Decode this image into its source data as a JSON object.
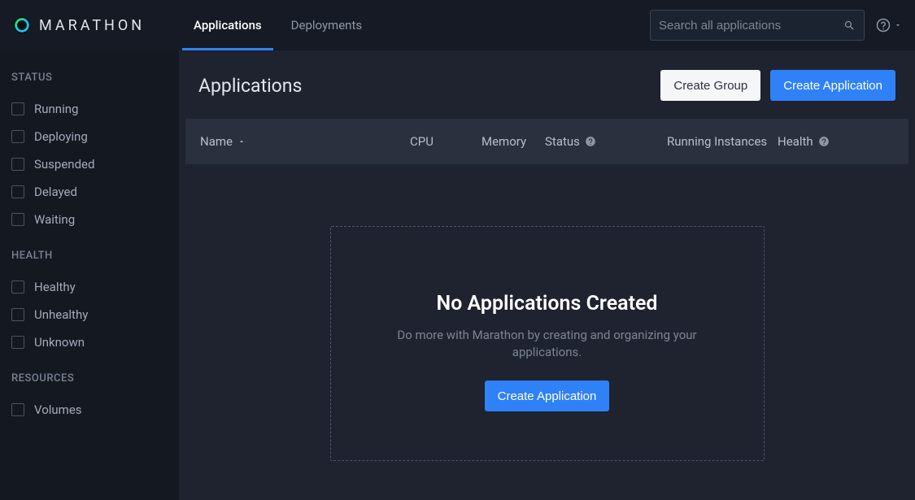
{
  "brand": "MARATHON",
  "nav": [
    {
      "label": "Applications",
      "active": true
    },
    {
      "label": "Deployments",
      "active": false
    }
  ],
  "search": {
    "placeholder": "Search all applications"
  },
  "page": {
    "title": "Applications",
    "create_group": "Create Group",
    "create_app": "Create Application"
  },
  "columns": {
    "name": "Name",
    "cpu": "CPU",
    "memory": "Memory",
    "status": "Status",
    "running": "Running Instances",
    "health": "Health"
  },
  "empty": {
    "title": "No Applications Created",
    "sub": "Do more with Marathon by creating and organizing your applications.",
    "cta": "Create Application"
  },
  "sidebar": {
    "status_heading": "STATUS",
    "status_items": [
      "Running",
      "Deploying",
      "Suspended",
      "Delayed",
      "Waiting"
    ],
    "health_heading": "HEALTH",
    "health_items": [
      "Healthy",
      "Unhealthy",
      "Unknown"
    ],
    "resources_heading": "RESOURCES",
    "resources_items": [
      "Volumes"
    ]
  }
}
